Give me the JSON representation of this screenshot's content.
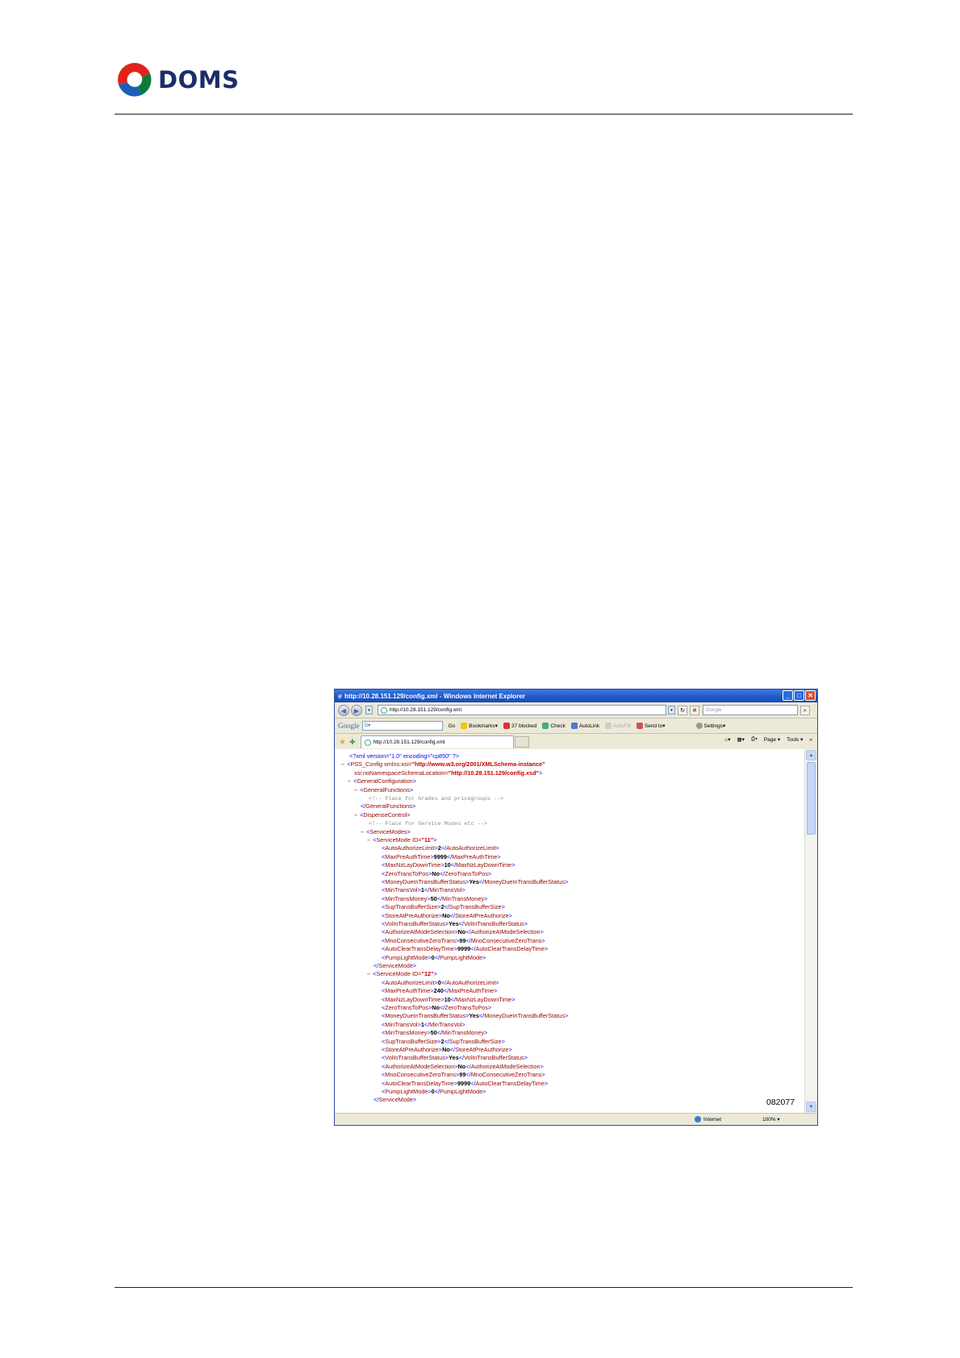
{
  "brand": {
    "name": "DOMS",
    "tm": "™"
  },
  "browser": {
    "title": "http://10.28.151.129/config.xml - Windows Internet Explorer",
    "address": "http://10.28.151.129/config.xml",
    "search_placeholder": "Google",
    "google_label": "Google",
    "google_box": "G▾",
    "toolbar": {
      "go": "Go",
      "bookmarks": "Bookmarks▾",
      "blocked": "37 blocked",
      "check": "Check",
      "autolink": "AutoLink",
      "autofill": "AutoFill",
      "send_to": "Send to▾",
      "settings": "Settings▾"
    },
    "tab_title": "http://10.28.151.129/config.xml",
    "page_menu": "Page",
    "tools_menu": "Tools",
    "status_zone": "Internet",
    "zoom": "100%"
  },
  "xml": {
    "decl": "<?xml version=\"1.0\" encoding=\"cp850\" ?>",
    "root_open": "<PSS_Config",
    "xmlns_attr": "xmlns:xsi=",
    "xmlns_val": "\"http://www.w3.org/2001/XMLSchema-instance\"",
    "schema_attr": "xsi:noNamespaceSchemaLocation=",
    "schema_val": "\"http://10.28.151.129/config.xsd\"",
    "general_config_open": "<GeneralConfiguration>",
    "general_functions_open": "<GeneralFunctions>",
    "comment_grades": "<!--  Place for Grades and pricegroups  -->",
    "general_functions_close": "</GeneralFunctions>",
    "dispense_open": "<DispenseControl>",
    "comment_service": "<!--  Place for Service Modes etc  -->",
    "service_modes_open": "<ServiceModes>",
    "service_mode_close": "</ServiceMode>",
    "mode1_id": "\"11\"",
    "mode2_id": "\"12\"",
    "service_mode_tag": "<ServiceMode ",
    "id_attr": "ID=",
    "mode1": [
      {
        "tag": "AutoAuthorizeLimit",
        "value": "2"
      },
      {
        "tag": "MaxPreAuthTime",
        "value": "9999"
      },
      {
        "tag": "MaxNzLayDownTime",
        "value": "10"
      },
      {
        "tag": "ZeroTransToPos",
        "value": "No"
      },
      {
        "tag": "MoneyDueInTransBufferStatus",
        "value": "Yes"
      },
      {
        "tag": "MinTransVol",
        "value": "1"
      },
      {
        "tag": "MinTransMoney",
        "value": "50"
      },
      {
        "tag": "SupTransBufferSize",
        "value": "2"
      },
      {
        "tag": "StoreAtPreAuthorize",
        "value": "No"
      },
      {
        "tag": "VolInTransBufferStatus",
        "value": "Yes"
      },
      {
        "tag": "AuthorizeAtModeSelection",
        "value": "No"
      },
      {
        "tag": "MnoConsecutiveZeroTrans",
        "value": "99"
      },
      {
        "tag": "AutoClearTransDelayTime",
        "value": "9999"
      },
      {
        "tag": "PumpLightMode",
        "value": "0"
      }
    ],
    "mode2": [
      {
        "tag": "AutoAuthorizeLimit",
        "value": "0"
      },
      {
        "tag": "MaxPreAuthTime",
        "value": "240"
      },
      {
        "tag": "MaxNzLayDownTime",
        "value": "10"
      },
      {
        "tag": "ZeroTransToPos",
        "value": "No"
      },
      {
        "tag": "MoneyDueInTransBufferStatus",
        "value": "Yes"
      },
      {
        "tag": "MinTransVol",
        "value": "1"
      },
      {
        "tag": "MinTransMoney",
        "value": "50"
      },
      {
        "tag": "SupTransBufferSize",
        "value": "2"
      },
      {
        "tag": "StoreAtPreAuthorize",
        "value": "No"
      },
      {
        "tag": "VolInTransBufferStatus",
        "value": "Yes"
      },
      {
        "tag": "AuthorizeAtModeSelection",
        "value": "No"
      },
      {
        "tag": "MnoConsecutiveZeroTrans",
        "value": "99"
      },
      {
        "tag": "AutoClearTransDelayTime",
        "value": "9999"
      },
      {
        "tag": "PumpLightMode",
        "value": "0"
      }
    ]
  },
  "figure_number": "082077",
  "colors": {
    "brand_blue": "#1a2d6b",
    "xml_tag": "#990000",
    "xml_bracket": "#0000ff",
    "ie_title": "#1f56c4"
  }
}
